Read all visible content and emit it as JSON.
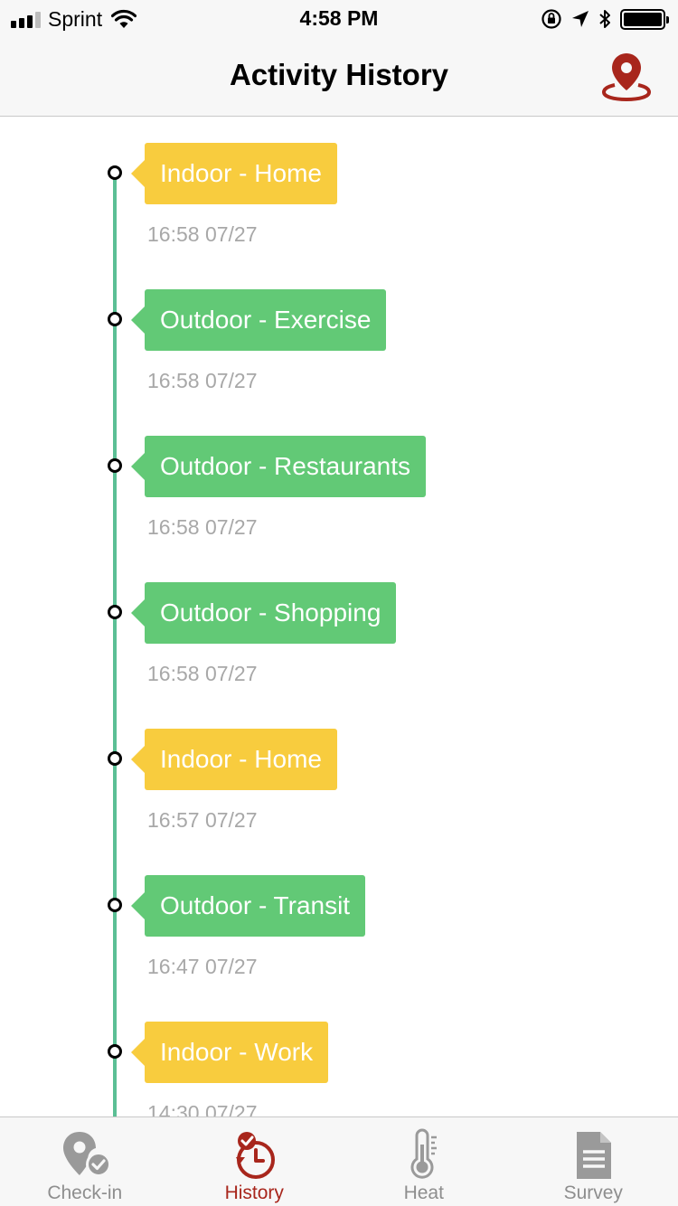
{
  "status_bar": {
    "carrier": "Sprint",
    "time": "4:58 PM"
  },
  "nav": {
    "title": "Activity History",
    "map_icon": "map-pin-icon",
    "accent_color": "#a8261c"
  },
  "timeline": {
    "entries": [
      {
        "label": "Indoor - Home",
        "time": "16:58 07/27",
        "kind": "indoor"
      },
      {
        "label": "Outdoor - Exercise",
        "time": "16:58 07/27",
        "kind": "outdoor"
      },
      {
        "label": "Outdoor - Restaurants",
        "time": "16:58 07/27",
        "kind": "outdoor"
      },
      {
        "label": "Outdoor - Shopping",
        "time": "16:58 07/27",
        "kind": "outdoor"
      },
      {
        "label": "Indoor - Home",
        "time": "16:57 07/27",
        "kind": "indoor"
      },
      {
        "label": "Outdoor - Transit",
        "time": "16:47 07/27",
        "kind": "outdoor"
      },
      {
        "label": "Indoor - Work",
        "time": "14:30 07/27",
        "kind": "indoor"
      }
    ],
    "colors": {
      "indoor": "#f8cc3e",
      "outdoor": "#62c976",
      "line": "#5bbf95"
    }
  },
  "tab_bar": {
    "tabs": [
      {
        "label": "Check-in",
        "icon": "check-in-pin-icon",
        "active": false
      },
      {
        "label": "History",
        "icon": "history-clock-icon",
        "active": true
      },
      {
        "label": "Heat",
        "icon": "thermometer-icon",
        "active": false
      },
      {
        "label": "Survey",
        "icon": "survey-document-icon",
        "active": false
      }
    ]
  }
}
